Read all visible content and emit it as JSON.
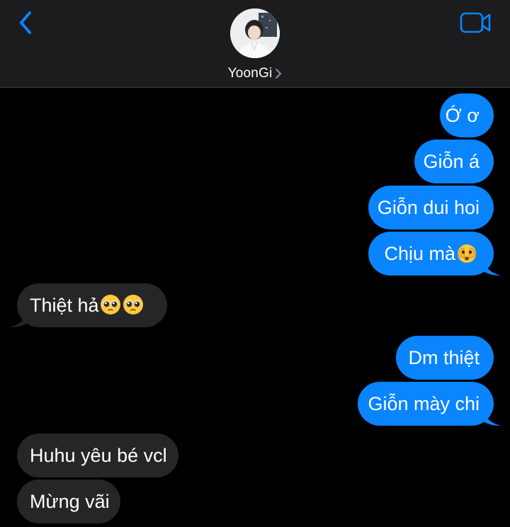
{
  "header": {
    "contact_name": "YoonGi",
    "back_icon": "chevron-left-icon",
    "video_icon": "video-camera-icon",
    "accent_color": "#0a84ff"
  },
  "messages": [
    {
      "dir": "out",
      "text": "Ớ ơ"
    },
    {
      "dir": "out",
      "text": "Giỗn á"
    },
    {
      "dir": "out",
      "text": "Giỗn dui hoi"
    },
    {
      "dir": "out",
      "text": "Chịu mà",
      "emoji": [
        "face-holding-back-tears-hand-over-eyes"
      ]
    },
    {
      "dir": "in",
      "text": "Thiệt hả",
      "emoji": [
        "pleading-face",
        "pleading-face"
      ]
    },
    {
      "dir": "out",
      "text": "Dm thiệt"
    },
    {
      "dir": "out",
      "text": "Giỗn mày chi"
    },
    {
      "dir": "in",
      "text": "Huhu yêu bé vcl"
    },
    {
      "dir": "in",
      "text": "Mừng vãi"
    }
  ],
  "colors": {
    "outgoing_bubble": "#0a84ff",
    "incoming_bubble": "#262629",
    "header_bg": "#1c1c1e",
    "background": "#000000"
  }
}
